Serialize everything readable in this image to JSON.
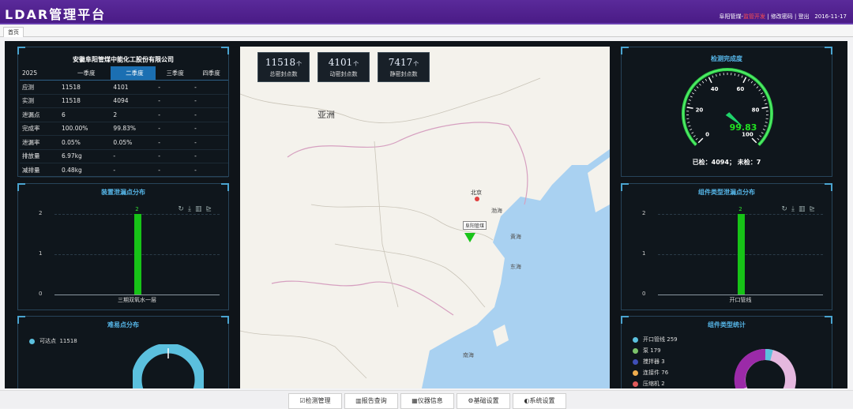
{
  "header": {
    "title": "LDAR管理平台",
    "user": "阜阳管煤-",
    "user_red": "监管开发",
    "links": "修改密码",
    "logout": "登出",
    "date": "2016-11-17"
  },
  "tabs": [
    {
      "label": "首页"
    }
  ],
  "summary": {
    "company": "安徽阜阳管煤中能化工股份有限公司",
    "year": "2025",
    "quarters": [
      "一季度",
      "二季度",
      "三季度",
      "四季度"
    ],
    "rows": [
      {
        "label": "应测",
        "vals": [
          "11518",
          "4101",
          "-",
          "-"
        ]
      },
      {
        "label": "实测",
        "vals": [
          "11518",
          "4094",
          "-",
          "-"
        ]
      },
      {
        "label": "泄漏点",
        "vals": [
          "6",
          "2",
          "-",
          "-"
        ]
      },
      {
        "label": "完成率",
        "vals": [
          "100.00%",
          "99.83%",
          "-",
          "-"
        ]
      },
      {
        "label": "泄漏率",
        "vals": [
          "0.05%",
          "0.05%",
          "-",
          "-"
        ]
      },
      {
        "label": "排放量",
        "vals": [
          "6.97kg",
          "-",
          "-",
          "-"
        ]
      },
      {
        "label": "减排量",
        "vals": [
          "0.48kg",
          "-",
          "-",
          "-"
        ]
      }
    ]
  },
  "leak_by_unit": {
    "title": "装置泄漏点分布",
    "icons": [
      "↻",
      "⤓",
      "▥",
      "⊵"
    ]
  },
  "difficult": {
    "title": "难易点分布",
    "legend": [
      {
        "label": "可达点",
        "value": "11518",
        "color": "#5bc0de"
      }
    ]
  },
  "kpis": [
    {
      "num": "11518",
      "unit": "个",
      "label": "总密封点数"
    },
    {
      "num": "4101",
      "unit": "个",
      "label": "动密封点数"
    },
    {
      "num": "7417",
      "unit": "个",
      "label": "静密封点数"
    }
  ],
  "map": {
    "labels": {
      "asia": "亚洲",
      "beijing": "北京",
      "marker": "阜阳管煤",
      "bohai": "渤海",
      "yellowsea": "黄海",
      "eastsea": "东海",
      "southsea": "南海"
    }
  },
  "gauge": {
    "title": "检测完成度",
    "value": 99.83,
    "value_text": "99.83",
    "ticks": [
      "0",
      "20",
      "40",
      "60",
      "80",
      "100"
    ],
    "checked_label": "已检：",
    "checked": "4094",
    "sep": "；  未检：",
    "unchecked": "7"
  },
  "leak_by_type": {
    "title": "组件类型泄漏点分布",
    "icons": [
      "↻",
      "⤓",
      "▥",
      "⊵"
    ]
  },
  "type_stats": {
    "title": "组件类型统计",
    "legend": [
      {
        "label": "开口管线",
        "value": "259",
        "color": "#5bc0de"
      },
      {
        "label": "泵",
        "value": "179",
        "color": "#7cc36b"
      },
      {
        "label": "搅拌器",
        "value": "3",
        "color": "#3f4fb8"
      },
      {
        "label": "连接件",
        "value": "76",
        "color": "#f0ad4e"
      },
      {
        "label": "压缩机",
        "value": "2",
        "color": "#e05a5a"
      }
    ]
  },
  "chart_data": [
    {
      "type": "bar",
      "title": "装置泄漏点分布",
      "categories": [
        "三期双氧水一层"
      ],
      "values": [
        2
      ],
      "ylim": [
        0,
        2
      ],
      "yticks": [
        "0",
        "1",
        "2"
      ]
    },
    {
      "type": "bar",
      "title": "组件类型泄漏点分布",
      "categories": [
        "开口管线"
      ],
      "values": [
        2
      ],
      "ylim": [
        0,
        2
      ],
      "yticks": [
        "0",
        "1",
        "2"
      ]
    }
  ],
  "bottom_nav": [
    {
      "label": "☑检测管理"
    },
    {
      "label": "▥报告查询"
    },
    {
      "label": "▦仪器信息"
    },
    {
      "label": "⚙基础设置"
    },
    {
      "label": "◐系统设置"
    }
  ]
}
